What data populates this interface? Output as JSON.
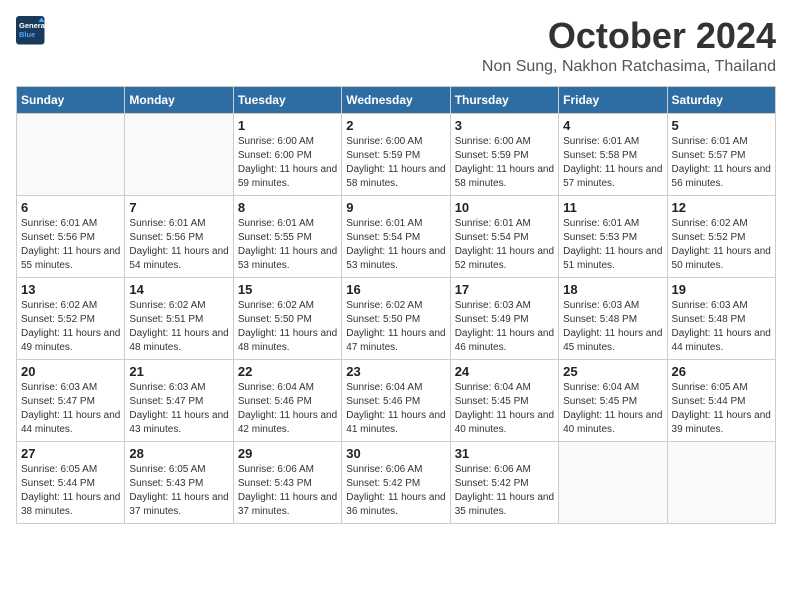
{
  "header": {
    "logo": {
      "line1": "General",
      "line2": "Blue"
    },
    "month": "October 2024",
    "location": "Non Sung, Nakhon Ratchasima, Thailand"
  },
  "days_of_week": [
    "Sunday",
    "Monday",
    "Tuesday",
    "Wednesday",
    "Thursday",
    "Friday",
    "Saturday"
  ],
  "weeks": [
    [
      {
        "day": "",
        "empty": true
      },
      {
        "day": "",
        "empty": true
      },
      {
        "day": "1",
        "sunrise": "Sunrise: 6:00 AM",
        "sunset": "Sunset: 6:00 PM",
        "daylight": "Daylight: 11 hours and 59 minutes."
      },
      {
        "day": "2",
        "sunrise": "Sunrise: 6:00 AM",
        "sunset": "Sunset: 5:59 PM",
        "daylight": "Daylight: 11 hours and 58 minutes."
      },
      {
        "day": "3",
        "sunrise": "Sunrise: 6:00 AM",
        "sunset": "Sunset: 5:59 PM",
        "daylight": "Daylight: 11 hours and 58 minutes."
      },
      {
        "day": "4",
        "sunrise": "Sunrise: 6:01 AM",
        "sunset": "Sunset: 5:58 PM",
        "daylight": "Daylight: 11 hours and 57 minutes."
      },
      {
        "day": "5",
        "sunrise": "Sunrise: 6:01 AM",
        "sunset": "Sunset: 5:57 PM",
        "daylight": "Daylight: 11 hours and 56 minutes."
      }
    ],
    [
      {
        "day": "6",
        "sunrise": "Sunrise: 6:01 AM",
        "sunset": "Sunset: 5:56 PM",
        "daylight": "Daylight: 11 hours and 55 minutes."
      },
      {
        "day": "7",
        "sunrise": "Sunrise: 6:01 AM",
        "sunset": "Sunset: 5:56 PM",
        "daylight": "Daylight: 11 hours and 54 minutes."
      },
      {
        "day": "8",
        "sunrise": "Sunrise: 6:01 AM",
        "sunset": "Sunset: 5:55 PM",
        "daylight": "Daylight: 11 hours and 53 minutes."
      },
      {
        "day": "9",
        "sunrise": "Sunrise: 6:01 AM",
        "sunset": "Sunset: 5:54 PM",
        "daylight": "Daylight: 11 hours and 53 minutes."
      },
      {
        "day": "10",
        "sunrise": "Sunrise: 6:01 AM",
        "sunset": "Sunset: 5:54 PM",
        "daylight": "Daylight: 11 hours and 52 minutes."
      },
      {
        "day": "11",
        "sunrise": "Sunrise: 6:01 AM",
        "sunset": "Sunset: 5:53 PM",
        "daylight": "Daylight: 11 hours and 51 minutes."
      },
      {
        "day": "12",
        "sunrise": "Sunrise: 6:02 AM",
        "sunset": "Sunset: 5:52 PM",
        "daylight": "Daylight: 11 hours and 50 minutes."
      }
    ],
    [
      {
        "day": "13",
        "sunrise": "Sunrise: 6:02 AM",
        "sunset": "Sunset: 5:52 PM",
        "daylight": "Daylight: 11 hours and 49 minutes."
      },
      {
        "day": "14",
        "sunrise": "Sunrise: 6:02 AM",
        "sunset": "Sunset: 5:51 PM",
        "daylight": "Daylight: 11 hours and 48 minutes."
      },
      {
        "day": "15",
        "sunrise": "Sunrise: 6:02 AM",
        "sunset": "Sunset: 5:50 PM",
        "daylight": "Daylight: 11 hours and 48 minutes."
      },
      {
        "day": "16",
        "sunrise": "Sunrise: 6:02 AM",
        "sunset": "Sunset: 5:50 PM",
        "daylight": "Daylight: 11 hours and 47 minutes."
      },
      {
        "day": "17",
        "sunrise": "Sunrise: 6:03 AM",
        "sunset": "Sunset: 5:49 PM",
        "daylight": "Daylight: 11 hours and 46 minutes."
      },
      {
        "day": "18",
        "sunrise": "Sunrise: 6:03 AM",
        "sunset": "Sunset: 5:48 PM",
        "daylight": "Daylight: 11 hours and 45 minutes."
      },
      {
        "day": "19",
        "sunrise": "Sunrise: 6:03 AM",
        "sunset": "Sunset: 5:48 PM",
        "daylight": "Daylight: 11 hours and 44 minutes."
      }
    ],
    [
      {
        "day": "20",
        "sunrise": "Sunrise: 6:03 AM",
        "sunset": "Sunset: 5:47 PM",
        "daylight": "Daylight: 11 hours and 44 minutes."
      },
      {
        "day": "21",
        "sunrise": "Sunrise: 6:03 AM",
        "sunset": "Sunset: 5:47 PM",
        "daylight": "Daylight: 11 hours and 43 minutes."
      },
      {
        "day": "22",
        "sunrise": "Sunrise: 6:04 AM",
        "sunset": "Sunset: 5:46 PM",
        "daylight": "Daylight: 11 hours and 42 minutes."
      },
      {
        "day": "23",
        "sunrise": "Sunrise: 6:04 AM",
        "sunset": "Sunset: 5:46 PM",
        "daylight": "Daylight: 11 hours and 41 minutes."
      },
      {
        "day": "24",
        "sunrise": "Sunrise: 6:04 AM",
        "sunset": "Sunset: 5:45 PM",
        "daylight": "Daylight: 11 hours and 40 minutes."
      },
      {
        "day": "25",
        "sunrise": "Sunrise: 6:04 AM",
        "sunset": "Sunset: 5:45 PM",
        "daylight": "Daylight: 11 hours and 40 minutes."
      },
      {
        "day": "26",
        "sunrise": "Sunrise: 6:05 AM",
        "sunset": "Sunset: 5:44 PM",
        "daylight": "Daylight: 11 hours and 39 minutes."
      }
    ],
    [
      {
        "day": "27",
        "sunrise": "Sunrise: 6:05 AM",
        "sunset": "Sunset: 5:44 PM",
        "daylight": "Daylight: 11 hours and 38 minutes."
      },
      {
        "day": "28",
        "sunrise": "Sunrise: 6:05 AM",
        "sunset": "Sunset: 5:43 PM",
        "daylight": "Daylight: 11 hours and 37 minutes."
      },
      {
        "day": "29",
        "sunrise": "Sunrise: 6:06 AM",
        "sunset": "Sunset: 5:43 PM",
        "daylight": "Daylight: 11 hours and 37 minutes."
      },
      {
        "day": "30",
        "sunrise": "Sunrise: 6:06 AM",
        "sunset": "Sunset: 5:42 PM",
        "daylight": "Daylight: 11 hours and 36 minutes."
      },
      {
        "day": "31",
        "sunrise": "Sunrise: 6:06 AM",
        "sunset": "Sunset: 5:42 PM",
        "daylight": "Daylight: 11 hours and 35 minutes."
      },
      {
        "day": "",
        "empty": true
      },
      {
        "day": "",
        "empty": true
      }
    ]
  ]
}
